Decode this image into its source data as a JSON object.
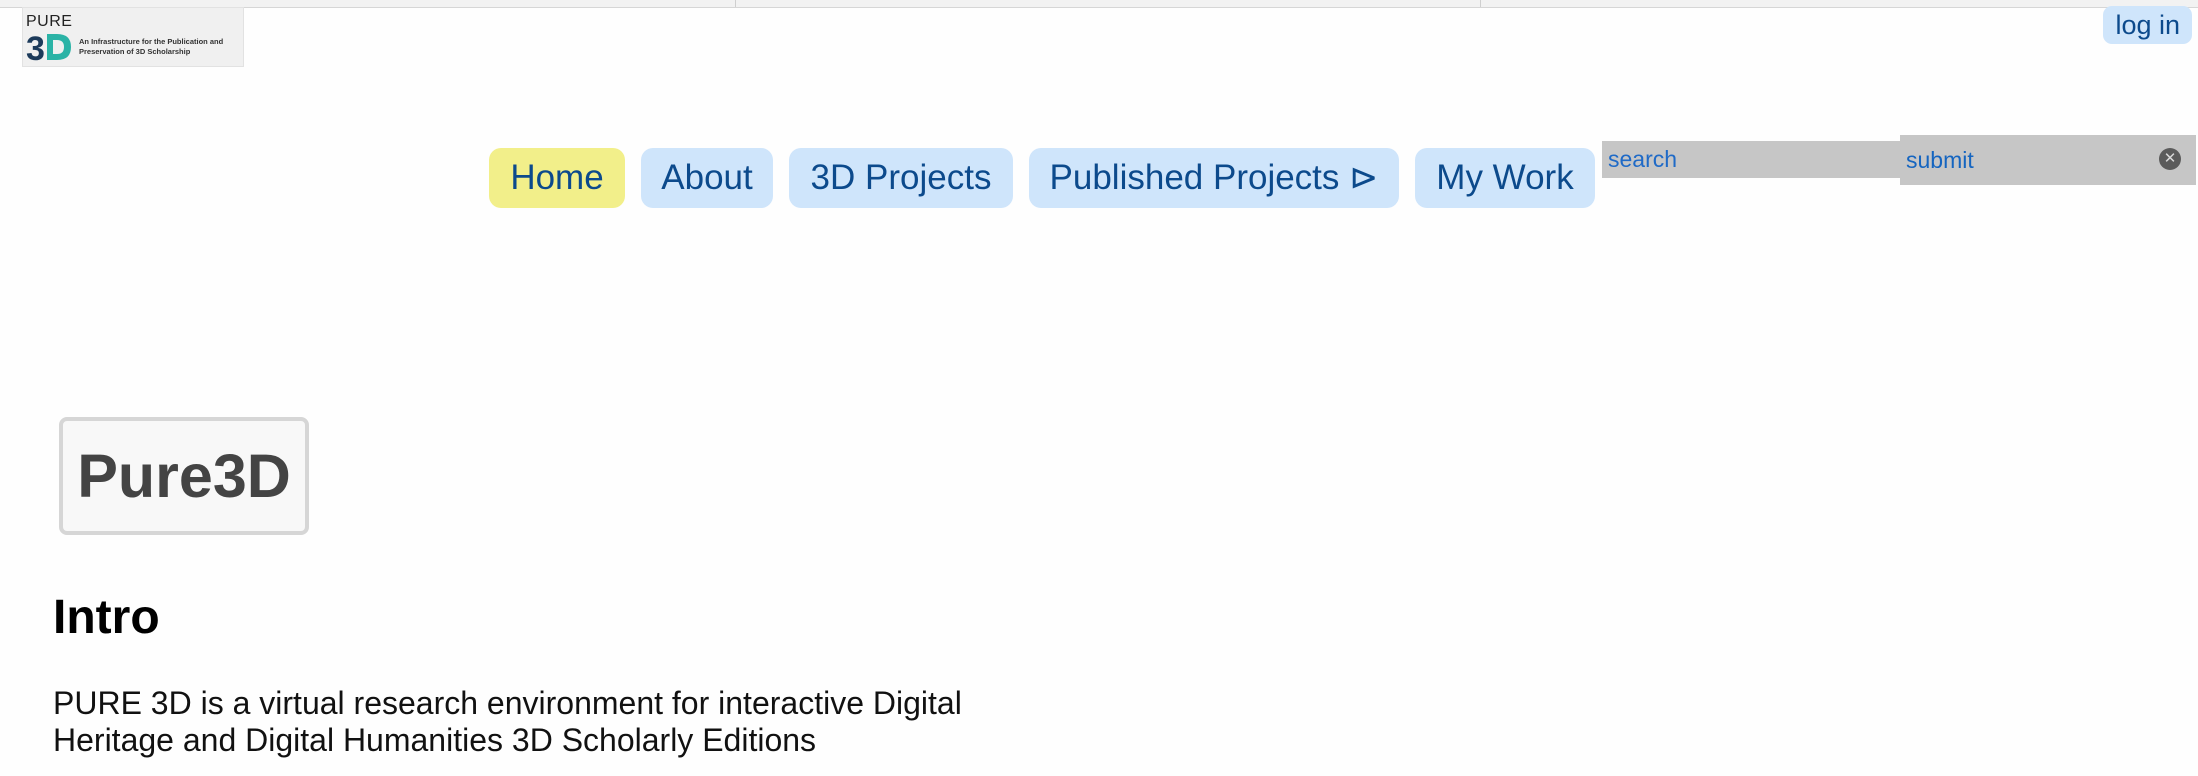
{
  "header": {
    "logo": {
      "brand_top": "PURE",
      "brand_mark": "3D",
      "tagline": "An Infrastructure for the Publication and Preservation of 3D Scholarship"
    },
    "login_label": "log in"
  },
  "nav": {
    "items": [
      {
        "label": "Home",
        "active": true
      },
      {
        "label": "About",
        "active": false
      },
      {
        "label": "3D Projects",
        "active": false
      },
      {
        "label": "Published Projects ⊳",
        "active": false
      },
      {
        "label": "My Work",
        "active": false
      }
    ]
  },
  "search": {
    "placeholder": "search",
    "submit_label": "submit",
    "clear_icon": "close-circle-icon"
  },
  "main": {
    "badge": "Pure3D",
    "heading": "Intro",
    "text": "PURE 3D is a virtual research environment for interactive Digital Heritage and Digital Humanities 3D Scholarly Editions"
  },
  "colors": {
    "nav_bg": "#cfe5fb",
    "nav_active_bg": "#f2ef8a",
    "nav_text": "#0c4a8c",
    "search_bg": "#c6c6c6",
    "link_blue": "#1565c0"
  }
}
